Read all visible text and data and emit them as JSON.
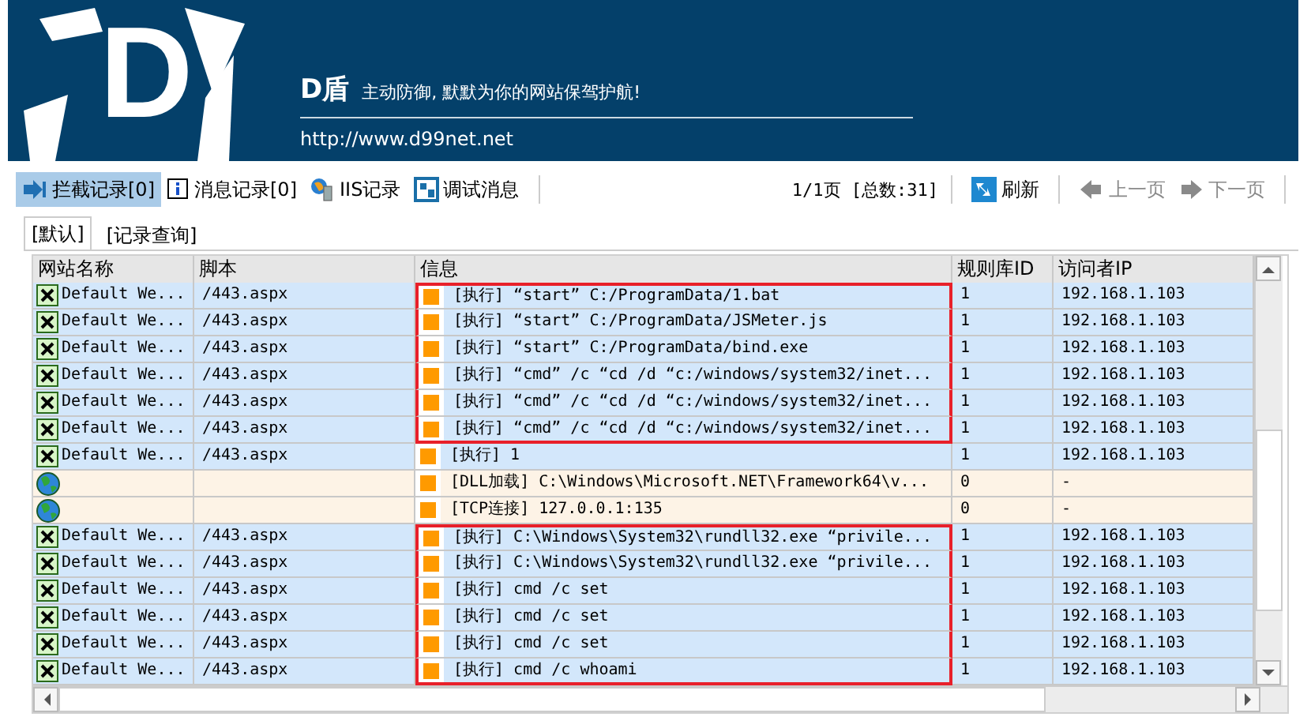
{
  "banner": {
    "logo_letter": "D",
    "brand": "D盾",
    "slogan": "主动防御, 默默为你的网站保驾护航!",
    "url": "http://www.d99net.net"
  },
  "toolbar": {
    "items": [
      {
        "kind": "intercept",
        "label": "拦截记录[0]",
        "selected": true
      },
      {
        "kind": "message",
        "label": "消息记录[0]",
        "selected": false
      },
      {
        "kind": "iis",
        "label": "IIS记录",
        "selected": false
      },
      {
        "kind": "debug",
        "label": "调试消息",
        "selected": false
      }
    ],
    "page_info": "1/1页 [总数:31]",
    "refresh": "刷新",
    "prev": {
      "label": "上一页",
      "disabled": true
    },
    "next": {
      "label": "下一页",
      "disabled": true
    }
  },
  "tabs": [
    {
      "label": "[默认]",
      "selected": true
    },
    {
      "label": "[记录查询]",
      "selected": false
    }
  ],
  "table": {
    "columns": [
      "网站名称",
      "脚本",
      "信息",
      "规则库ID",
      "访问者IP"
    ],
    "rows": [
      {
        "kind": "web",
        "site": "Default We...",
        "script": "/443.aspx",
        "info": "[执行] “start” C:/ProgramData/1.bat",
        "rule_id": "1",
        "visitor_ip": "192.168.1.103",
        "flagged": true
      },
      {
        "kind": "web",
        "site": "Default We...",
        "script": "/443.aspx",
        "info": "[执行] “start” C:/ProgramData/JSMeter.js",
        "rule_id": "1",
        "visitor_ip": "192.168.1.103",
        "flagged": true
      },
      {
        "kind": "web",
        "site": "Default We...",
        "script": "/443.aspx",
        "info": "[执行] “start” C:/ProgramData/bind.exe",
        "rule_id": "1",
        "visitor_ip": "192.168.1.103",
        "flagged": true
      },
      {
        "kind": "web",
        "site": "Default We...",
        "script": "/443.aspx",
        "info": "[执行] “cmd” /c “cd /d “c:/windows/system32/inet...",
        "rule_id": "1",
        "visitor_ip": "192.168.1.103",
        "flagged": true
      },
      {
        "kind": "web",
        "site": "Default We...",
        "script": "/443.aspx",
        "info": "[执行] “cmd” /c “cd /d “c:/windows/system32/inet...",
        "rule_id": "1",
        "visitor_ip": "192.168.1.103",
        "flagged": true
      },
      {
        "kind": "web",
        "site": "Default We...",
        "script": "/443.aspx",
        "info": "[执行] “cmd” /c “cd /d “c:/windows/system32/inet...",
        "rule_id": "1",
        "visitor_ip": "192.168.1.103",
        "flagged": true
      },
      {
        "kind": "web",
        "site": "Default We...",
        "script": "/443.aspx",
        "info": "[执行] 1",
        "rule_id": "1",
        "visitor_ip": "192.168.1.103",
        "flagged": false
      },
      {
        "kind": "system",
        "info": "[DLL加载] C:\\Windows\\Microsoft.NET\\Framework64\\v...",
        "rule_id": "0",
        "visitor_ip": "-",
        "flagged": false
      },
      {
        "kind": "system",
        "info": "[TCP连接] 127.0.0.1:135",
        "rule_id": "0",
        "visitor_ip": "-",
        "flagged": false
      },
      {
        "kind": "web",
        "site": "Default We...",
        "script": "/443.aspx",
        "info": "[执行] C:\\Windows\\System32\\rundll32.exe “privile...",
        "rule_id": "1",
        "visitor_ip": "192.168.1.103",
        "flagged": true
      },
      {
        "kind": "web",
        "site": "Default We...",
        "script": "/443.aspx",
        "info": "[执行] C:\\Windows\\System32\\rundll32.exe “privile...",
        "rule_id": "1",
        "visitor_ip": "192.168.1.103",
        "flagged": true
      },
      {
        "kind": "web",
        "site": "Default We...",
        "script": "/443.aspx",
        "info": "[执行] cmd /c set",
        "rule_id": "1",
        "visitor_ip": "192.168.1.103",
        "flagged": true
      },
      {
        "kind": "web",
        "site": "Default We...",
        "script": "/443.aspx",
        "info": "[执行] cmd /c set",
        "rule_id": "1",
        "visitor_ip": "192.168.1.103",
        "flagged": true
      },
      {
        "kind": "web",
        "site": "Default We...",
        "script": "/443.aspx",
        "info": "[执行] cmd /c set",
        "rule_id": "1",
        "visitor_ip": "192.168.1.103",
        "flagged": true
      },
      {
        "kind": "web",
        "site": "Default We...",
        "script": "/443.aspx",
        "info": "[执行] cmd /c whoami",
        "rule_id": "1",
        "visitor_ip": "192.168.1.103",
        "flagged": true
      }
    ]
  }
}
